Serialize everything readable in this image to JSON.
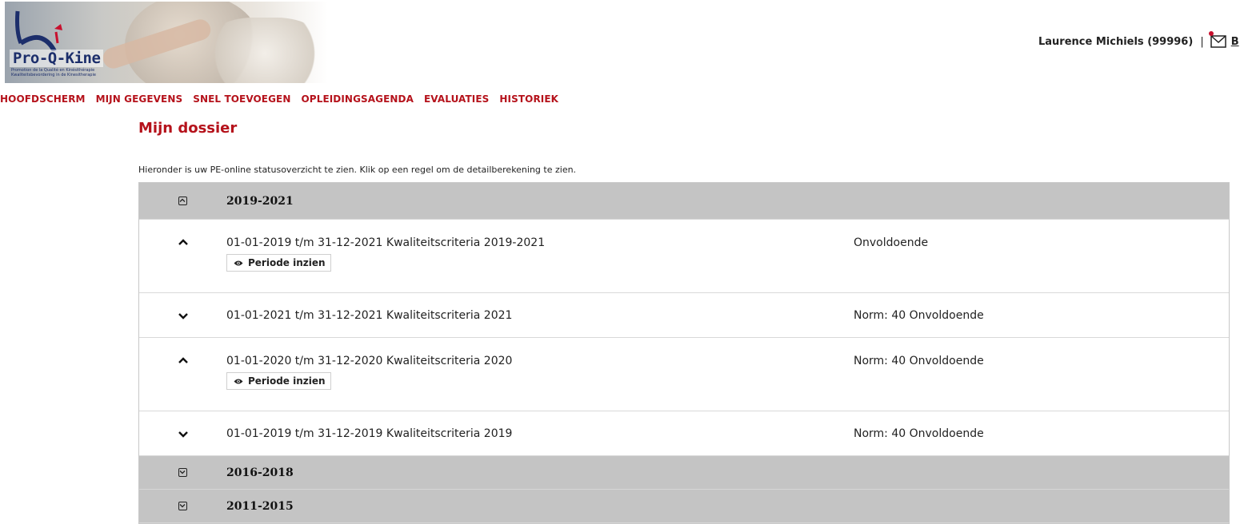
{
  "header": {
    "logo_text": "Pro-Q-Kine",
    "logo_subtitle_1": "Promotion de la Qualité en Kinésithérapie",
    "logo_subtitle_2": "Kwaliteitsbevordering in de Kinesitherapie",
    "user_name": "Laurence Michiels (99996)",
    "separator": "|",
    "mail_icon": "envelope-icon",
    "truncated_link": "B"
  },
  "nav": {
    "items": [
      "HOOFDSCHERM",
      "MIJN GEGEVENS",
      "SNEL TOEVOEGEN",
      "OPLEIDINGSAGENDA",
      "EVALUATIES",
      "HISTORIEK"
    ]
  },
  "page": {
    "title": "Mijn dossier",
    "intro": "Hieronder is uw PE-online statusoverzicht te zien. Klik op een regel om de detailberekening te zien."
  },
  "table": {
    "group1": {
      "label": "2019-2021",
      "expanded": true
    },
    "rows": [
      {
        "desc": "01-01-2019 t/m 31-12-2021 Kwaliteitscriteria 2019-2021",
        "status": "Onvoldoende",
        "expanded": true,
        "button": "Periode inzien"
      },
      {
        "desc": "01-01-2021 t/m 31-12-2021 Kwaliteitscriteria 2021",
        "status": "Norm: 40 Onvoldoende",
        "expanded": false
      },
      {
        "desc": "01-01-2020 t/m 31-12-2020 Kwaliteitscriteria 2020",
        "status": "Norm: 40 Onvoldoende",
        "expanded": true,
        "button": "Periode inzien"
      },
      {
        "desc": "01-01-2019 t/m 31-12-2019 Kwaliteitscriteria 2019",
        "status": "Norm: 40 Onvoldoende",
        "expanded": false
      }
    ],
    "group2": {
      "label": "2016-2018",
      "expanded": false
    },
    "group3": {
      "label": "2011-2015",
      "expanded": false
    }
  },
  "colors": {
    "accent": "#b5121b",
    "group_bg": "#c4c4c4",
    "logo_blue": "#1c2e6b"
  }
}
